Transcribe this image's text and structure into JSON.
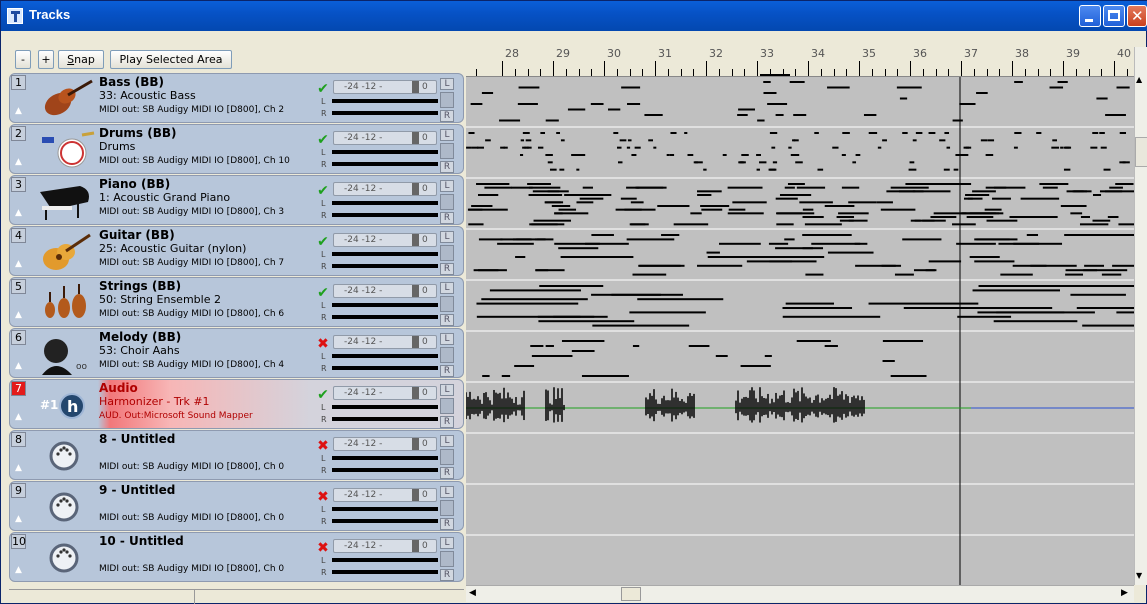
{
  "window": {
    "title": "Tracks"
  },
  "toolbar": {
    "zoom_out": "-",
    "zoom_in": "+",
    "snap_prefix": "",
    "snap_u": "S",
    "snap_rest": "nap",
    "play_label": "Play Selected Area"
  },
  "ruler": {
    "bars": [
      "28",
      "29",
      "30",
      "31",
      "32",
      "33",
      "34",
      "35",
      "36",
      "37",
      "38",
      "39",
      "40"
    ]
  },
  "tracks": [
    {
      "num": "1",
      "name": "Bass  (BB)",
      "instrument": "33: Acoustic Bass",
      "output": "MIDI out: SB Audigy MIDI IO [D800], Ch 2",
      "status": "✔",
      "muted": false,
      "icon": "bass-icon"
    },
    {
      "num": "2",
      "name": "Drums  (BB)",
      "instrument": "Drums",
      "output": "MIDI out: SB Audigy MIDI IO [D800], Ch 10",
      "status": "✔",
      "muted": false,
      "icon": "drums-icon"
    },
    {
      "num": "3",
      "name": "Piano  (BB)",
      "instrument": "1: Acoustic Grand Piano",
      "output": "MIDI out: SB Audigy MIDI IO [D800], Ch 3",
      "status": "✔",
      "muted": false,
      "icon": "piano-icon"
    },
    {
      "num": "4",
      "name": "Guitar  (BB)",
      "instrument": "25: Acoustic Guitar (nylon)",
      "output": "MIDI out: SB Audigy MIDI IO [D800], Ch 7",
      "status": "✔",
      "muted": false,
      "icon": "guitar-icon"
    },
    {
      "num": "5",
      "name": "Strings (BB)",
      "instrument": "50: String Ensemble 2",
      "output": "MIDI out: SB Audigy MIDI IO [D800], Ch 6",
      "status": "✔",
      "muted": false,
      "icon": "strings-icon"
    },
    {
      "num": "6",
      "name": "Melody  (BB)",
      "instrument": "53: Choir Aahs",
      "output": "MIDI out: SB Audigy MIDI IO [D800], Ch 4",
      "status": "✖",
      "muted": true,
      "icon": "choir-icon"
    },
    {
      "num": "7",
      "name": "Audio",
      "instrument": "Harmonizer - Trk #1",
      "output": "AUD. Out:Microsoft Sound Mapper",
      "status": "✔",
      "muted": false,
      "icon": "harmonizer-icon"
    },
    {
      "num": "8",
      "name": "8 - Untitled",
      "instrument": "",
      "output": "MIDI out: SB Audigy MIDI IO [D800], Ch 0",
      "status": "✖",
      "muted": true,
      "icon": "midi-port-icon"
    },
    {
      "num": "9",
      "name": "9 - Untitled",
      "instrument": "",
      "output": "MIDI out: SB Audigy MIDI IO [D800], Ch 0",
      "status": "✖",
      "muted": true,
      "icon": "midi-port-icon"
    },
    {
      "num": "10",
      "name": "10 - Untitled",
      "instrument": "",
      "output": "MIDI out: SB Audigy MIDI IO [D800], Ch 0",
      "status": "✖",
      "muted": true,
      "icon": "midi-port-icon"
    }
  ],
  "mixer": {
    "scale": "-24  -12  -",
    "zero": "0",
    "l_label": "L",
    "r_label": "R",
    "side_l": "L",
    "side_r": "R"
  },
  "harmonizer_badge": "#1",
  "colors": {
    "titlebar": "#0752c6",
    "track_panel": "#b7c6da",
    "selected_track": "#e31b1b",
    "ok": "#1ea01e",
    "muted": "#d11111"
  }
}
